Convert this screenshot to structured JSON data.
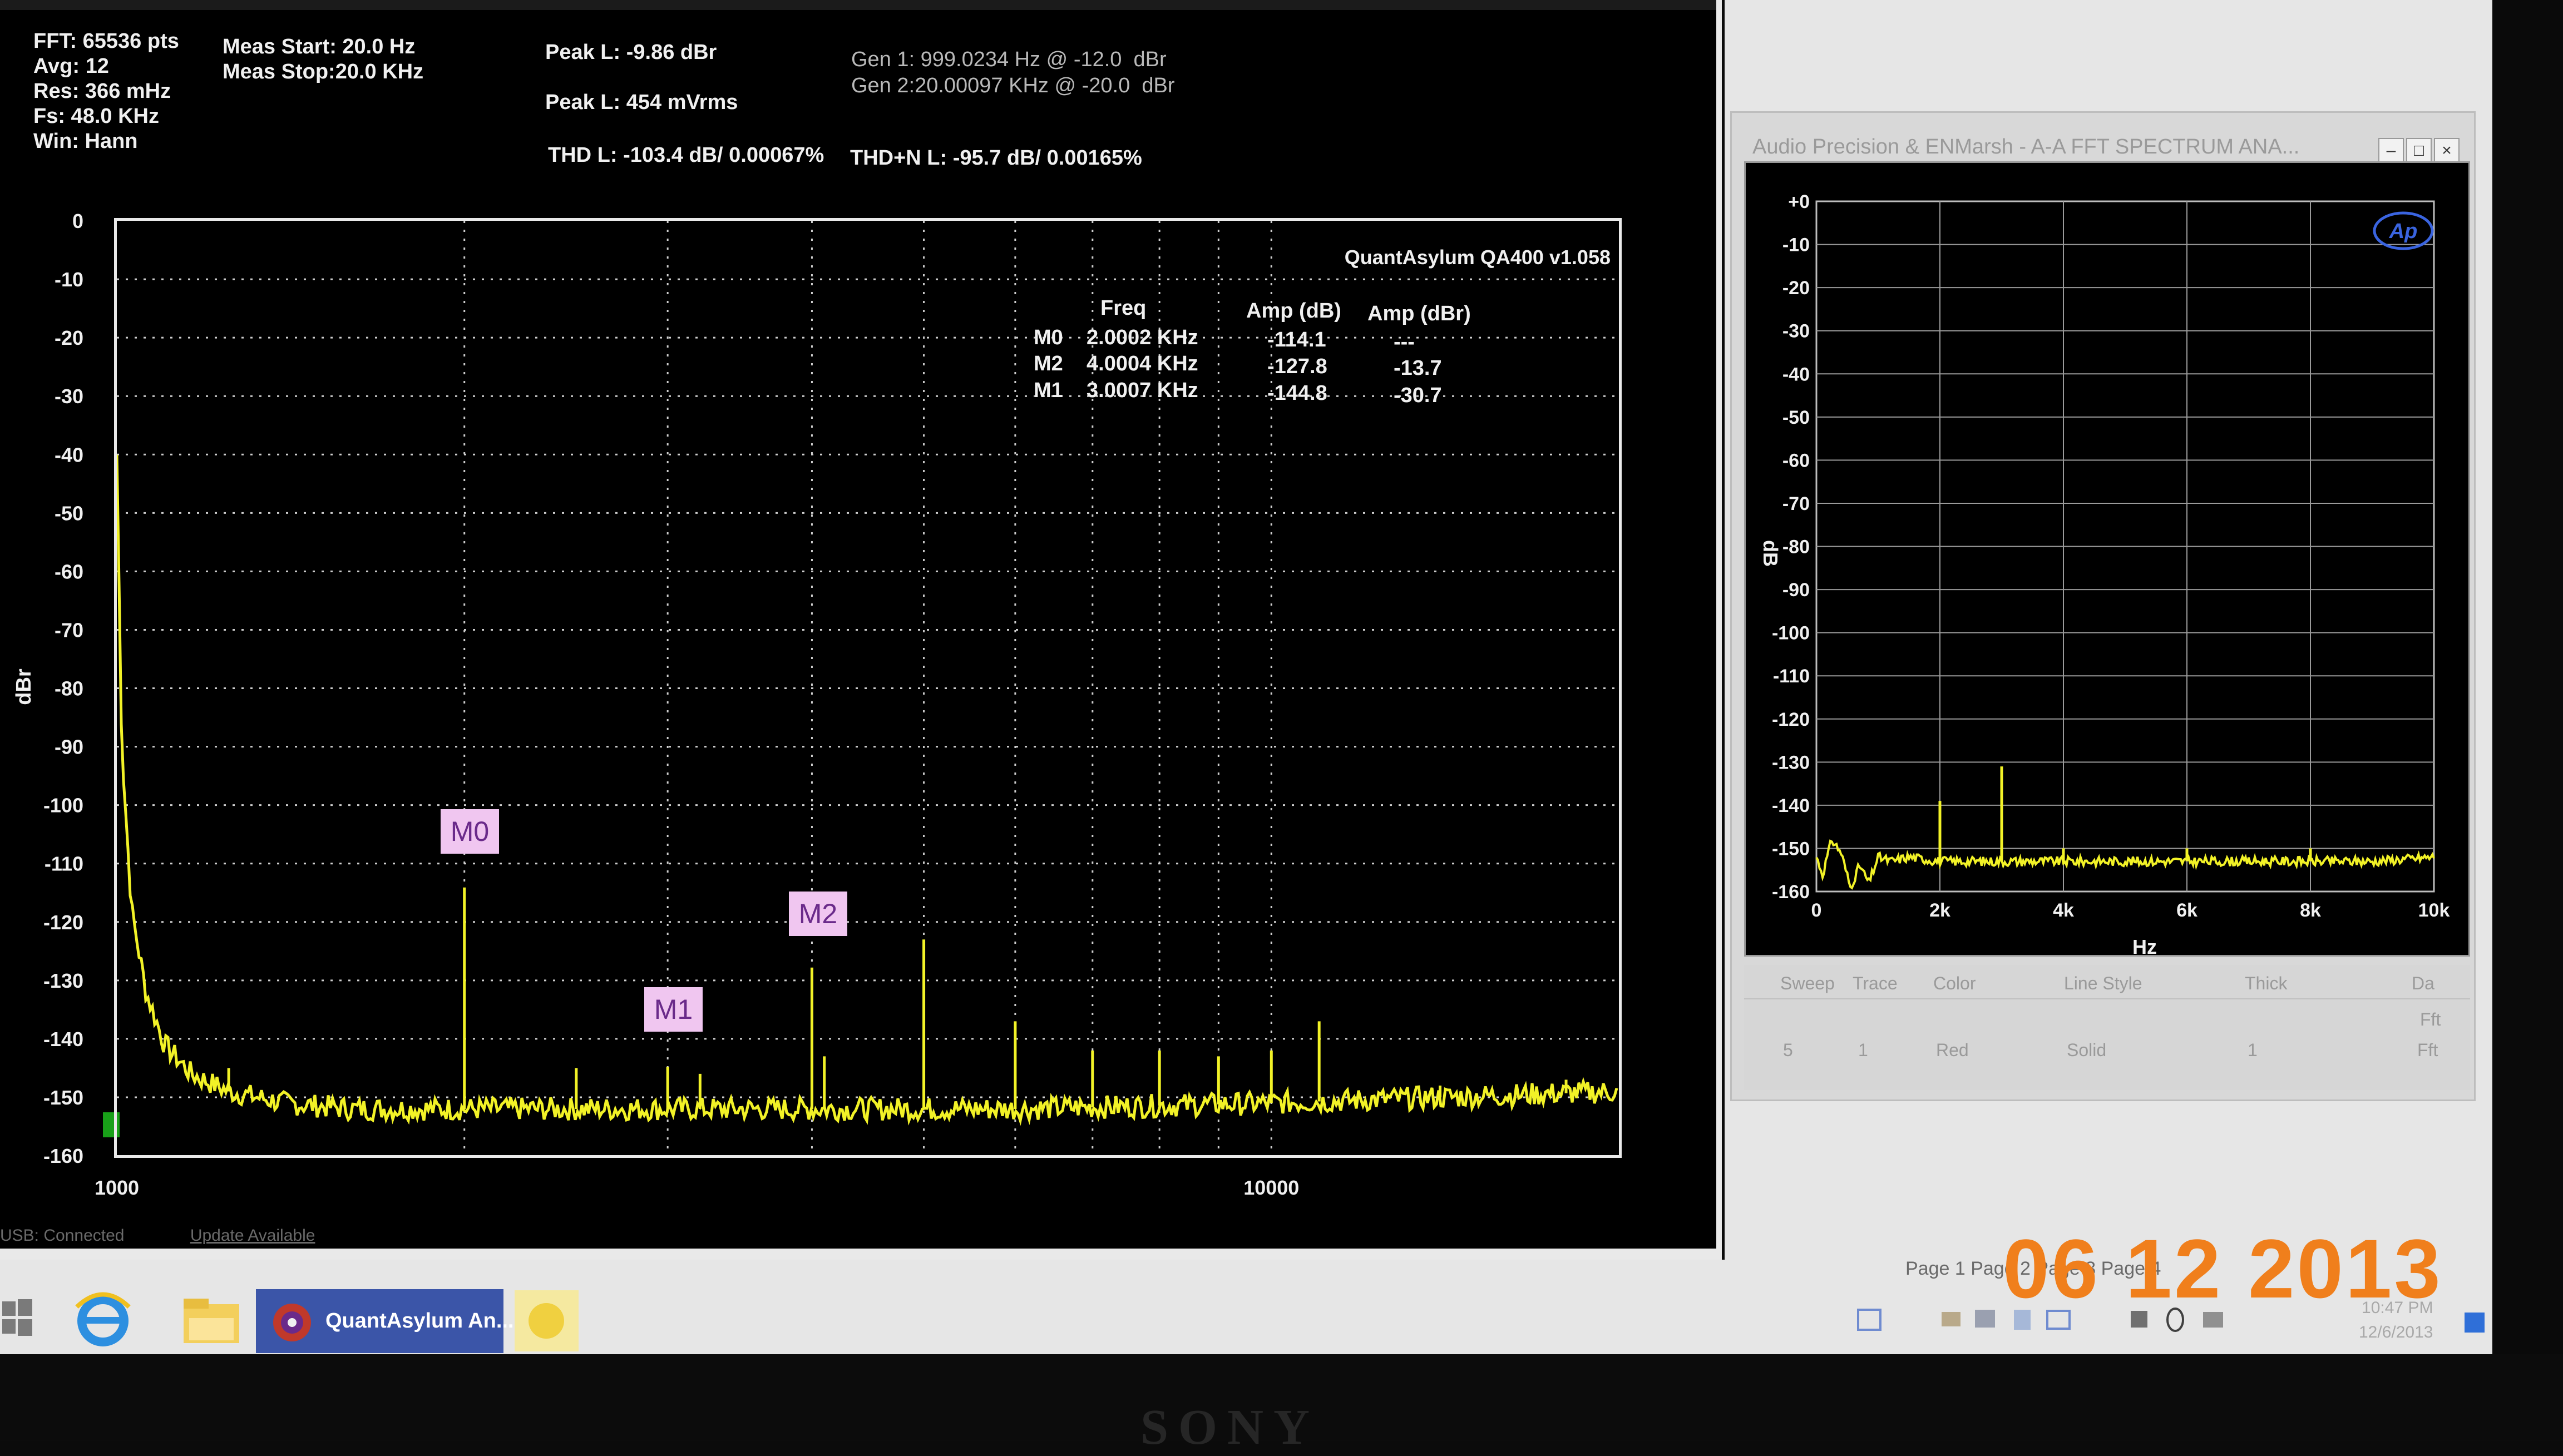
{
  "qa": {
    "info": {
      "fft": "FFT: 65536 pts",
      "avg": "Avg: 12",
      "res": "Res: 366 mHz",
      "fs": "Fs: 48.0 KHz",
      "win": "Win: Hann",
      "meas_start": "Meas Start: 20.0 Hz",
      "meas_stop": "Meas Stop:20.0 KHz",
      "peak_dbr": "Peak L: -9.86 dBr",
      "peak_mvrms": "Peak L: 454 mVrms",
      "thd": "THD L: -103.4 dB/ 0.00067%",
      "thdn": "THD+N L: -95.7 dB/ 0.00165%",
      "gen1": "Gen 1: 999.0234 Hz @ -12.0  dBr",
      "gen2": "Gen 2:20.00097 KHz @ -20.0  dBr"
    },
    "plot": {
      "version": "QuantAsylum QA400 v1.058",
      "ylabel": "dBr",
      "yticks": [
        "0",
        "-10",
        "-20",
        "-30",
        "-40",
        "-50",
        "-60",
        "-70",
        "-80",
        "-90",
        "-100",
        "-110",
        "-120",
        "-130",
        "-140",
        "-150",
        "-160"
      ],
      "xticks": [
        "1000",
        "10000"
      ],
      "markers_header": {
        "freq": "Freq",
        "amp_db": "Amp (dB)",
        "amp_dbr": "Amp (dBr)"
      },
      "markers": [
        {
          "id": "M0",
          "freq": "2.0002 KHz",
          "amp_db": "-114.1",
          "amp_dbr": "---"
        },
        {
          "id": "M2",
          "freq": "4.0004 KHz",
          "amp_db": "-127.8",
          "amp_dbr": "-13.7"
        },
        {
          "id": "M1",
          "freq": "3.0007 KHz",
          "amp_db": "-144.8",
          "amp_dbr": "-30.7"
        }
      ],
      "marker_flags": [
        "M0",
        "M2",
        "M1"
      ],
      "colors": {
        "trace": "#f2f227",
        "grid": "#cfcfcf",
        "marker_flag": "#f0c6f0",
        "marker_text": "#6a2a8a"
      }
    },
    "status": {
      "usb": "USB: Connected",
      "update": "Update Available"
    }
  },
  "chart_data": [
    {
      "type": "line",
      "title": "",
      "xlabel": "",
      "ylabel": "dBr",
      "x_scale": "log",
      "xlim": [
        1000,
        20000
      ],
      "ylim": [
        -160,
        0
      ],
      "grid": true,
      "series": [
        {
          "x": [
            1000,
            1010,
            1030,
            1060,
            1100,
            1160,
            1250,
            1400,
            1600,
            2000,
            3000,
            4000,
            6000,
            10000,
            20000
          ],
          "y": [
            -40,
            -90,
            -118,
            -132,
            -141,
            -146,
            -149,
            -151,
            -152,
            -152,
            -152,
            -152,
            -152,
            -151,
            -149
          ]
        }
      ],
      "peaks": {
        "x": [
          1250,
          2000,
          2500,
          3000,
          3200,
          4000,
          4100,
          5000,
          6000,
          7000,
          8000,
          9000,
          10000,
          11000,
          14000,
          18000
        ],
        "y": [
          -145,
          -114.1,
          -145,
          -144.8,
          -146,
          -127.8,
          -143,
          -123,
          -137,
          -142,
          -142,
          -143,
          -142,
          -137,
          -148,
          -147
        ]
      }
    },
    {
      "type": "line",
      "title": "A-A FFT SPECTRUM ANA...",
      "xlabel": "Hz",
      "ylabel": "dB",
      "xlim": [
        0,
        10000
      ],
      "ylim": [
        -160,
        0
      ],
      "xticks": [
        "0",
        "2k",
        "4k",
        "6k",
        "8k",
        "10k"
      ],
      "yticks": [
        "+0",
        "-10",
        "-20",
        "-30",
        "-40",
        "-50",
        "-60",
        "-70",
        "-80",
        "-90",
        "-100",
        "-110",
        "-120",
        "-130",
        "-140",
        "-150",
        "-160"
      ],
      "grid": true,
      "series": [
        {
          "x": [
            0,
            100,
            250,
            400,
            550,
            700,
            850,
            1000,
            1200,
            1500,
            2000,
            3000,
            4000,
            5000,
            6000,
            7000,
            8000,
            9000,
            10000
          ],
          "y": [
            -152,
            -156,
            -148,
            -151,
            -159,
            -154,
            -158,
            -152,
            -153,
            -152,
            -153,
            -153,
            -153,
            -153,
            -153,
            -153,
            -153,
            -153,
            -152
          ]
        }
      ],
      "peaks": {
        "x": [
          2000,
          3000,
          4000,
          6000,
          8000
        ],
        "y": [
          -139,
          -131,
          -150,
          -150,
          -150
        ]
      }
    }
  ],
  "ap": {
    "title": "Audio Precision & ENMarsh - A-A FFT SPECTRUM ANA...",
    "logo": "Ap",
    "table_header": [
      "Sweep",
      "Trace",
      "Color",
      "Line Style",
      "Thick",
      "Da"
    ],
    "table_row": [
      "5",
      "1",
      "Red",
      "Solid",
      "1",
      "Fft"
    ],
    "table_row_prev": [
      "",
      "",
      "",
      "",
      "",
      "Fft"
    ]
  },
  "taskbar": {
    "app_label": "QuantAsylum An...",
    "pages": "Page 1  Page 2  Page 3  Page 4",
    "time": "10:47 PM",
    "date": "12/6/2013"
  },
  "photo": {
    "date_stamp": "06 12 2013",
    "brand": "SONY"
  }
}
